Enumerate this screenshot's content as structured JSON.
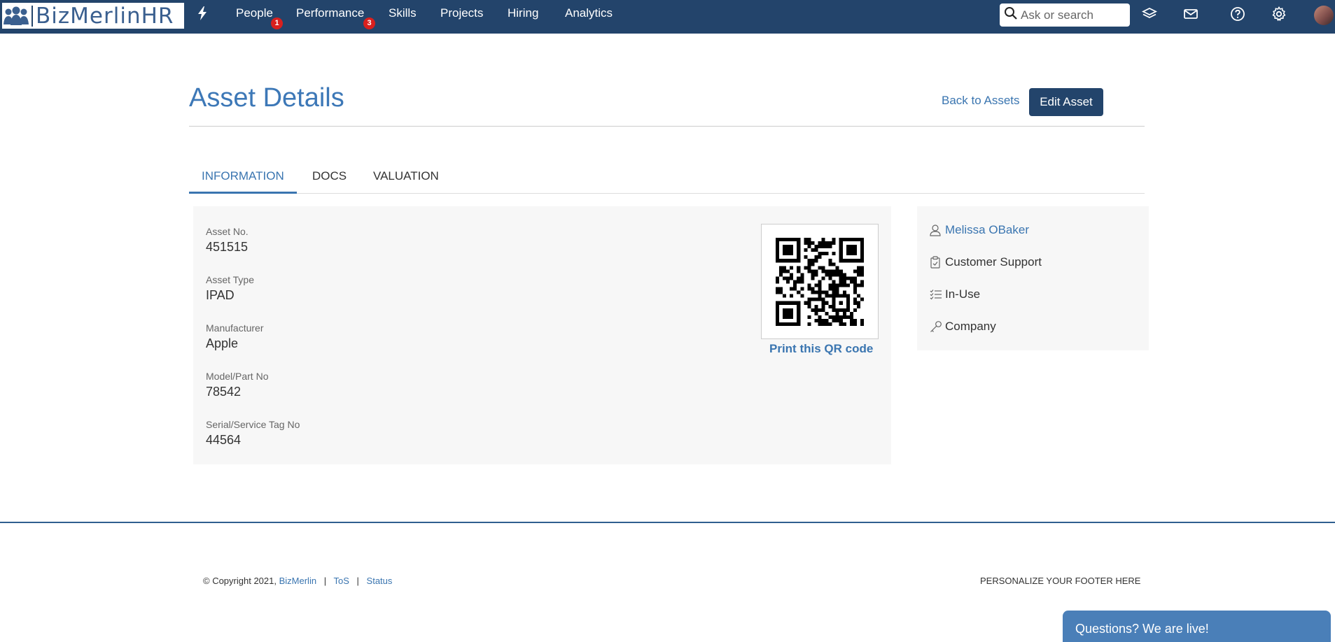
{
  "brand": {
    "name": "BizMerlinHR"
  },
  "nav": {
    "items": [
      {
        "label": "People",
        "badge": "1"
      },
      {
        "label": "Performance",
        "badge": "3"
      },
      {
        "label": "Skills"
      },
      {
        "label": "Projects"
      },
      {
        "label": "Hiring"
      },
      {
        "label": "Analytics"
      }
    ],
    "search_placeholder": "Ask or search",
    "icons": [
      "bolt-icon",
      "search-icon",
      "layers-icon",
      "mail-icon",
      "help-icon",
      "gear-icon",
      "avatar"
    ]
  },
  "header": {
    "title": "Asset Details",
    "back_label": "Back to Assets",
    "edit_label": "Edit Asset"
  },
  "tabs": [
    {
      "label": "INFORMATION",
      "active": true
    },
    {
      "label": "DOCS"
    },
    {
      "label": "VALUATION"
    }
  ],
  "fields": [
    {
      "label": "Asset No.",
      "value": "451515"
    },
    {
      "label": "Asset Type",
      "value": "IPAD"
    },
    {
      "label": "Manufacturer",
      "value": "Apple"
    },
    {
      "label": "Model/Part No",
      "value": "78542"
    },
    {
      "label": "Serial/Service Tag No",
      "value": "44564"
    }
  ],
  "qr": {
    "print_label": "Print this QR code"
  },
  "side": {
    "owner": "Melissa OBaker",
    "department": "Customer Support",
    "status": "In-Use",
    "ownership": "Company"
  },
  "footer": {
    "copyright": "© Copyright 2021,",
    "brand_link": "BizMerlin",
    "tos": "ToS",
    "status": "Status",
    "right_text": "PERSONALIZE YOUR FOOTER HERE"
  },
  "chat": {
    "label": "Questions? We are live!"
  },
  "colors": {
    "navbar": "#23446b",
    "accent": "#3a75b0",
    "badge": "#d9201e",
    "panel": "#f7f7f7"
  }
}
